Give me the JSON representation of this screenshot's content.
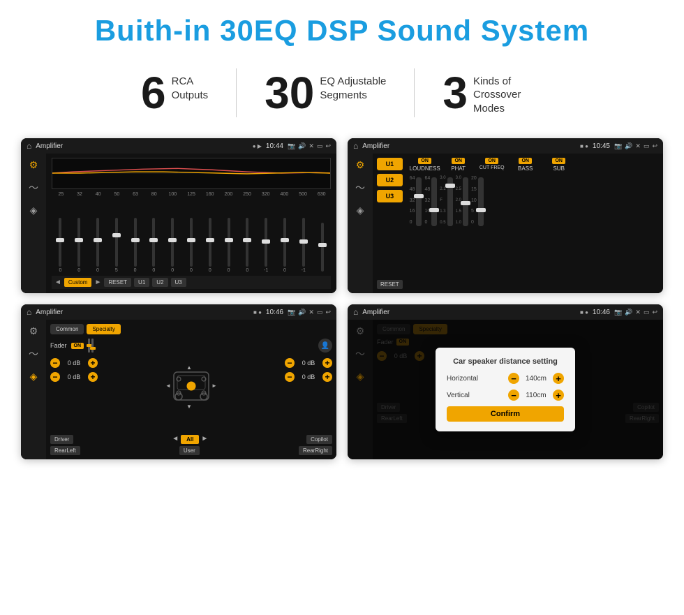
{
  "page": {
    "title": "Buith-in 30EQ DSP Sound System"
  },
  "stats": [
    {
      "number": "6",
      "text_line1": "RCA",
      "text_line2": "Outputs"
    },
    {
      "number": "30",
      "text_line1": "EQ Adjustable",
      "text_line2": "Segments"
    },
    {
      "number": "3",
      "text_line1": "Kinds of",
      "text_line2": "Crossover Modes"
    }
  ],
  "screen1": {
    "app_name": "Amplifier",
    "time": "10:44",
    "eq_labels": [
      "25",
      "32",
      "40",
      "50",
      "63",
      "80",
      "100",
      "125",
      "160",
      "200",
      "250",
      "320",
      "400",
      "500",
      "630"
    ],
    "eq_values": [
      "0",
      "0",
      "0",
      "5",
      "0",
      "0",
      "0",
      "0",
      "0",
      "0",
      "0",
      "-1",
      "0",
      "-1"
    ],
    "buttons": [
      "Custom",
      "RESET",
      "U1",
      "U2",
      "U3"
    ]
  },
  "screen2": {
    "app_name": "Amplifier",
    "time": "10:45",
    "presets": [
      "U1",
      "U2",
      "U3"
    ],
    "channels": [
      {
        "label": "LOUDNESS",
        "on": true
      },
      {
        "label": "PHAT",
        "on": true
      },
      {
        "label": "CUT FREQ",
        "on": true
      },
      {
        "label": "BASS",
        "on": true
      },
      {
        "label": "SUB",
        "on": true
      }
    ],
    "reset_label": "RESET"
  },
  "screen3": {
    "app_name": "Amplifier",
    "time": "10:46",
    "tabs": [
      "Common",
      "Specialty"
    ],
    "fader_label": "Fader",
    "fader_on": "ON",
    "db_values": [
      "0 dB",
      "0 dB",
      "0 dB",
      "0 dB"
    ],
    "bottom_buttons": [
      "Driver",
      "All",
      "Copilot",
      "RearLeft",
      "User",
      "RearRight"
    ]
  },
  "screen4": {
    "app_name": "Amplifier",
    "time": "10:46",
    "tabs": [
      "Common",
      "Specialty"
    ],
    "dialog": {
      "title": "Car speaker distance setting",
      "horizontal_label": "Horizontal",
      "horizontal_value": "140cm",
      "vertical_label": "Vertical",
      "vertical_value": "110cm",
      "confirm_label": "Confirm"
    },
    "db_values": [
      "0 dB",
      "0 dB"
    ],
    "bottom_buttons": [
      "Driver",
      "Copilot",
      "RearLeft",
      "RearRight"
    ]
  }
}
